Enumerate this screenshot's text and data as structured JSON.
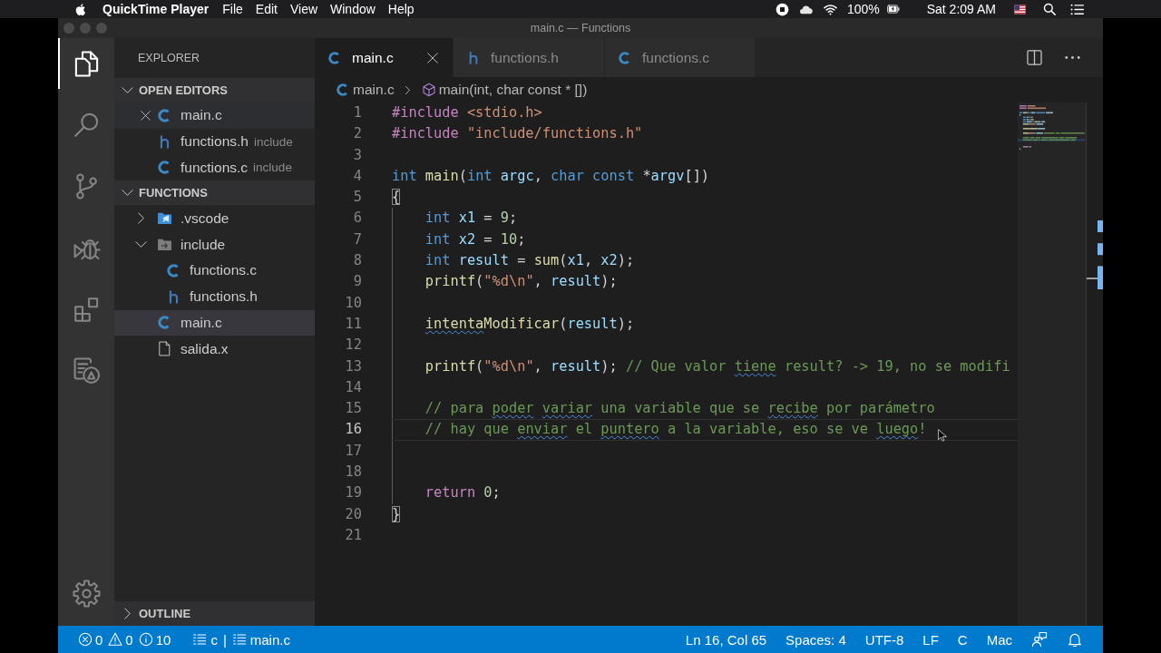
{
  "menu_bar": {
    "app_name": "QuickTime Player",
    "menus": [
      "File",
      "Edit",
      "View",
      "Window",
      "Help"
    ],
    "battery": "100%",
    "clock": "Sat 2:09 AM"
  },
  "window": {
    "title": "main.c — Functions"
  },
  "activity_bar": {
    "items": [
      {
        "kind": "files",
        "selected": true
      },
      {
        "kind": "search",
        "selected": false
      },
      {
        "kind": "source-control",
        "selected": false
      },
      {
        "kind": "debug",
        "selected": false
      },
      {
        "kind": "extensions",
        "selected": false
      },
      {
        "kind": "panel",
        "selected": false
      }
    ]
  },
  "sidebar": {
    "title": "EXPLORER",
    "open_editors": {
      "title": "OPEN EDITORS",
      "expanded": true,
      "items": [
        {
          "label": "main.c",
          "kind": "c",
          "selected": true
        },
        {
          "label": "functions.h",
          "kind": "h",
          "description": "include",
          "selected": false
        },
        {
          "label": "functions.c",
          "kind": "c",
          "description": "include",
          "selected": false
        }
      ]
    },
    "folder": {
      "title": "FUNCTIONS",
      "expanded": true,
      "items": [
        {
          "label": ".vscode",
          "kind": "vscode-folder",
          "expanded": false,
          "selected": false
        },
        {
          "label": "include",
          "kind": "folder",
          "expanded": true,
          "selected": false,
          "children": [
            {
              "label": "functions.c",
              "kind": "c",
              "selected": false
            },
            {
              "label": "functions.h",
              "kind": "h",
              "selected": false
            }
          ]
        },
        {
          "label": "main.c",
          "kind": "c",
          "selected": true
        },
        {
          "label": "salida.x",
          "kind": "file",
          "selected": false
        }
      ]
    },
    "outline": {
      "title": "OUTLINE",
      "expanded": false
    }
  },
  "tabs": [
    {
      "label": "main.c",
      "kind": "c",
      "selected": true
    },
    {
      "label": "functions.h",
      "kind": "h",
      "selected": false
    },
    {
      "label": "functions.c",
      "kind": "c",
      "selected": false
    }
  ],
  "breadcrumbs": [
    {
      "label": "main.c",
      "kind": "c"
    },
    {
      "label": "main(int, char const * [])",
      "kind": "method"
    }
  ],
  "editor": {
    "lines": [
      {
        "number": "1",
        "current": false,
        "tokens": [
          {
            "text": "#include ",
            "kind": "preproc",
            "flagged": false
          },
          {
            "text": "<stdio.h>",
            "kind": "string",
            "flagged": false
          }
        ]
      },
      {
        "number": "2",
        "current": false,
        "tokens": [
          {
            "text": "#include ",
            "kind": "preproc",
            "flagged": false
          },
          {
            "text": "\"include/functions.h\"",
            "kind": "string",
            "flagged": false
          }
        ]
      },
      {
        "number": "3",
        "current": false
      },
      {
        "number": "4",
        "current": false,
        "tokens": [
          {
            "text": "int ",
            "kind": "keyword",
            "flagged": false
          },
          {
            "text": "main",
            "kind": "function",
            "flagged": false
          },
          {
            "text": "(",
            "kind": "plain",
            "flagged": false
          },
          {
            "text": "int ",
            "kind": "keyword",
            "flagged": false
          },
          {
            "text": "argc",
            "kind": "variable",
            "flagged": false
          },
          {
            "text": ", ",
            "kind": "plain",
            "flagged": false
          },
          {
            "text": "char const ",
            "kind": "keyword",
            "flagged": false
          },
          {
            "text": "*",
            "kind": "plain",
            "flagged": false
          },
          {
            "text": "argv",
            "kind": "variable",
            "flagged": false
          },
          {
            "text": "[])",
            "kind": "plain",
            "flagged": false
          }
        ]
      },
      {
        "number": "5",
        "current": false,
        "tokens": [
          {
            "text": "{",
            "kind": "brace-match",
            "flagged": false
          }
        ]
      },
      {
        "number": "6",
        "current": false,
        "tokens": [
          {
            "text": "    int ",
            "kind": "keyword",
            "flagged": false
          },
          {
            "text": "x1",
            "kind": "variable",
            "flagged": false
          },
          {
            "text": " = ",
            "kind": "plain",
            "flagged": false
          },
          {
            "text": "9",
            "kind": "number",
            "flagged": false
          },
          {
            "text": ";",
            "kind": "plain",
            "flagged": false
          }
        ]
      },
      {
        "number": "7",
        "current": false,
        "tokens": [
          {
            "text": "    int ",
            "kind": "keyword",
            "flagged": false
          },
          {
            "text": "x2",
            "kind": "variable",
            "flagged": false
          },
          {
            "text": " = ",
            "kind": "plain",
            "flagged": false
          },
          {
            "text": "10",
            "kind": "number",
            "flagged": false
          },
          {
            "text": ";",
            "kind": "plain",
            "flagged": false
          }
        ]
      },
      {
        "number": "8",
        "current": false,
        "tokens": [
          {
            "text": "    int ",
            "kind": "keyword",
            "flagged": false
          },
          {
            "text": "result",
            "kind": "variable",
            "flagged": false
          },
          {
            "text": " = ",
            "kind": "plain",
            "flagged": false
          },
          {
            "text": "sum",
            "kind": "function",
            "flagged": false
          },
          {
            "text": "(",
            "kind": "plain",
            "flagged": false
          },
          {
            "text": "x1",
            "kind": "variable",
            "flagged": false
          },
          {
            "text": ", ",
            "kind": "plain",
            "flagged": false
          },
          {
            "text": "x2",
            "kind": "variable",
            "flagged": false
          },
          {
            "text": ");",
            "kind": "plain",
            "flagged": false
          }
        ]
      },
      {
        "number": "9",
        "current": false,
        "tokens": [
          {
            "text": "    printf",
            "kind": "function",
            "flagged": false
          },
          {
            "text": "(",
            "kind": "plain",
            "flagged": false
          },
          {
            "text": "\"%d\\n\"",
            "kind": "string",
            "flagged": false
          },
          {
            "text": ", ",
            "kind": "plain",
            "flagged": false
          },
          {
            "text": "result",
            "kind": "variable",
            "flagged": false
          },
          {
            "text": ");",
            "kind": "plain",
            "flagged": false
          }
        ]
      },
      {
        "number": "10",
        "current": false
      },
      {
        "number": "11",
        "current": false,
        "tokens": [
          {
            "text": "    intenta",
            "kind": "function",
            "flagged": true
          },
          {
            "text": "Modificar",
            "kind": "function",
            "flagged": false
          },
          {
            "text": "(",
            "kind": "plain",
            "flagged": false
          },
          {
            "text": "result",
            "kind": "variable",
            "flagged": false
          },
          {
            "text": ");",
            "kind": "plain",
            "flagged": false
          }
        ]
      },
      {
        "number": "12",
        "current": false
      },
      {
        "number": "13",
        "current": false,
        "tokens": [
          {
            "text": "    printf",
            "kind": "function",
            "flagged": false
          },
          {
            "text": "(",
            "kind": "plain",
            "flagged": false
          },
          {
            "text": "\"%d\\n\"",
            "kind": "string",
            "flagged": false
          },
          {
            "text": ", ",
            "kind": "plain",
            "flagged": false
          },
          {
            "text": "result",
            "kind": "variable",
            "flagged": false
          },
          {
            "text": "); ",
            "kind": "plain",
            "flagged": false
          },
          {
            "text": "// Que valor ",
            "kind": "comment",
            "flagged": false
          },
          {
            "text": "tiene",
            "kind": "comment",
            "flagged": true
          },
          {
            "text": " result? -> 19, no se modifi",
            "kind": "comment",
            "flagged": false
          }
        ]
      },
      {
        "number": "14",
        "current": false
      },
      {
        "number": "15",
        "current": false,
        "tokens": [
          {
            "text": "    // para ",
            "kind": "comment",
            "flagged": false
          },
          {
            "text": "poder ",
            "kind": "comment",
            "flagged": true
          },
          {
            "text": "variar",
            "kind": "comment",
            "flagged": true
          },
          {
            "text": " una variable que se ",
            "kind": "comment",
            "flagged": false
          },
          {
            "text": "recibe",
            "kind": "comment",
            "flagged": true
          },
          {
            "text": " por parámetro",
            "kind": "comment",
            "flagged": false
          }
        ]
      },
      {
        "number": "16",
        "current": true,
        "tokens": [
          {
            "text": "    // hay que ",
            "kind": "comment",
            "flagged": false
          },
          {
            "text": "enviar",
            "kind": "comment",
            "flagged": true
          },
          {
            "text": " el ",
            "kind": "comment",
            "flagged": false
          },
          {
            "text": "puntero",
            "kind": "comment",
            "flagged": true
          },
          {
            "text": " a la variable, eso se ve ",
            "kind": "comment",
            "flagged": false
          },
          {
            "text": "luego",
            "kind": "comment",
            "flagged": true
          },
          {
            "text": "!",
            "kind": "comment",
            "flagged": false
          }
        ]
      },
      {
        "number": "17",
        "current": false
      },
      {
        "number": "18",
        "current": false
      },
      {
        "number": "19",
        "current": false,
        "tokens": [
          {
            "text": "    return ",
            "kind": "control",
            "flagged": false
          },
          {
            "text": "0",
            "kind": "number",
            "flagged": false
          },
          {
            "text": ";",
            "kind": "plain",
            "flagged": false
          }
        ]
      },
      {
        "number": "20",
        "current": false,
        "tokens": [
          {
            "text": "}",
            "kind": "brace-match",
            "flagged": false
          }
        ]
      },
      {
        "number": "21",
        "current": false
      }
    ]
  },
  "status_bar": {
    "problems": [
      {
        "kind": "error",
        "count": "0"
      },
      {
        "kind": "warning",
        "count": "0"
      },
      {
        "kind": "info",
        "count": "10"
      }
    ],
    "scope": [
      "c",
      "main.c"
    ],
    "scope_separator": "|",
    "items": [
      "Ln 16, Col 65",
      "Spaces: 4",
      "UTF-8",
      "LF",
      "C",
      "Mac"
    ]
  }
}
